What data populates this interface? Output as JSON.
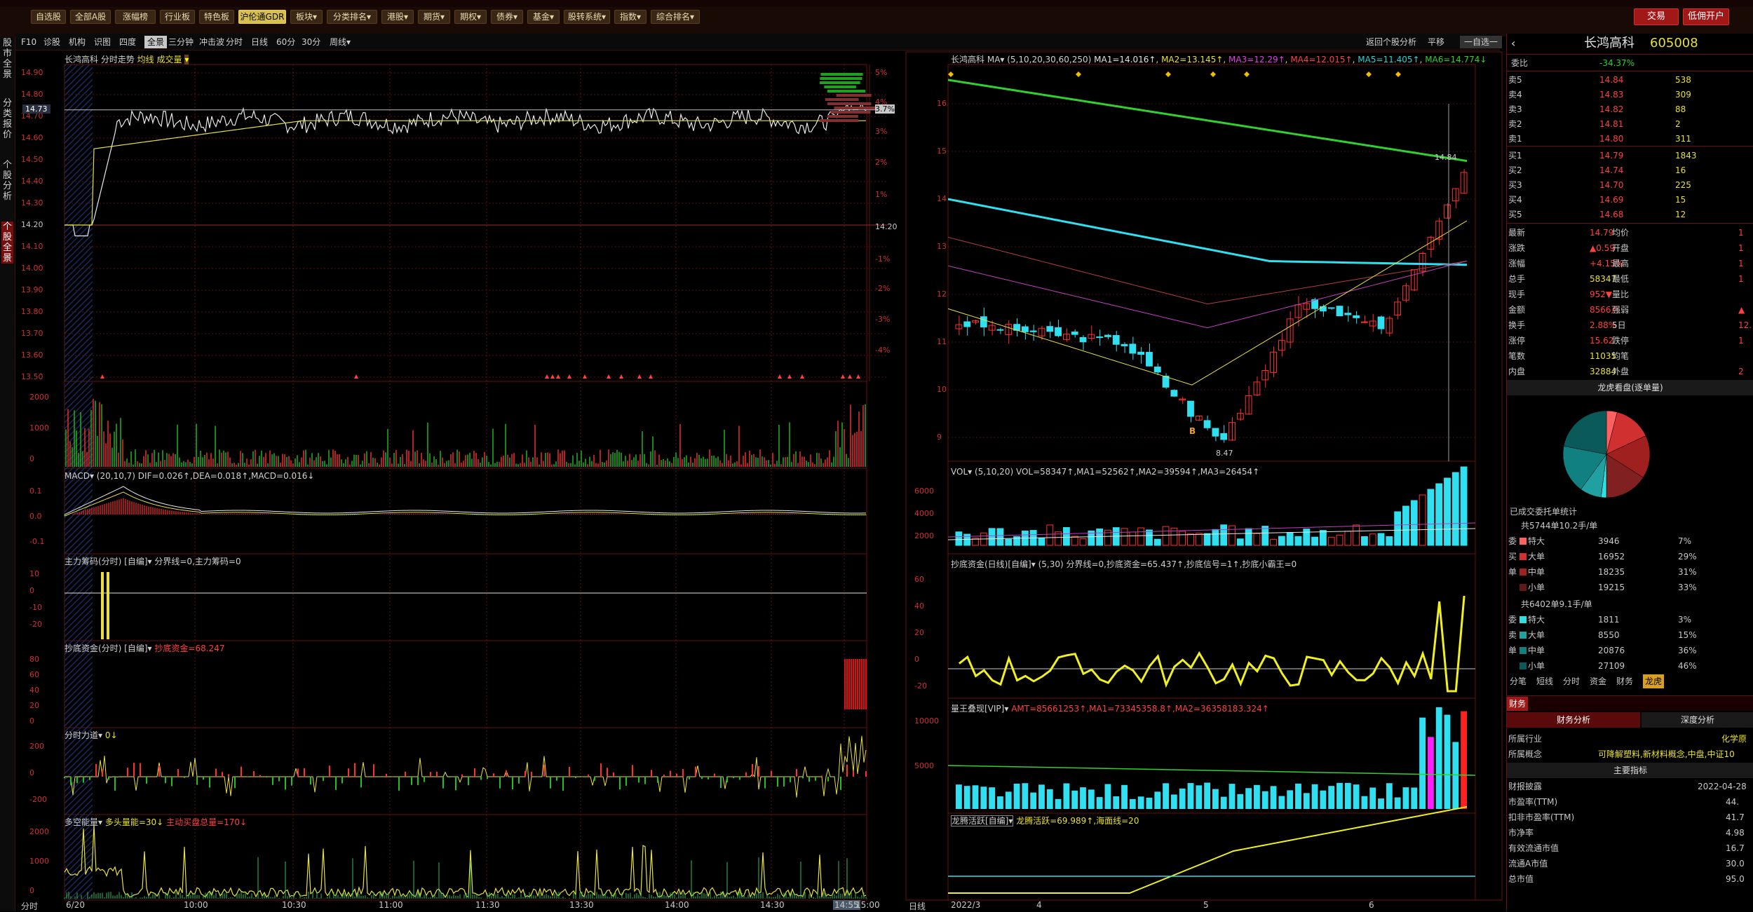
{
  "top": {
    "menu": [
      "自选股",
      "全部A股",
      "涨幅榜",
      "行业板",
      "特色板",
      "沪伦通GDR",
      "板块▾",
      "分类排名▾",
      "港股▾",
      "期货▾",
      "期权▾",
      "债券▾",
      "基金▾",
      "股转系统▾",
      "指数▾",
      "综合排名▾"
    ],
    "trade_btn": "交易",
    "account_btn": "低佣开户"
  },
  "left_tabs": [
    "股市全景",
    "分类报价",
    "个股分析",
    "个股全景"
  ],
  "toolbar": {
    "items": [
      "F10",
      "诊股",
      "机构",
      "识图",
      "四度",
      "全景",
      "三分钟",
      "冲击波",
      "分时",
      "日线",
      "60分",
      "30分",
      "周线▾"
    ],
    "right": [
      "返回个股分析",
      "平移",
      "一自选一"
    ]
  },
  "intraday": {
    "title": "长鸿高科 分时走势",
    "subtitle": "均线 成交量",
    "price_ticks": [
      "14.90",
      "14.80",
      "14.70",
      "14.60",
      "14.50",
      "14.40",
      "14.30",
      "14.20",
      "14.10",
      "14.00",
      "13.90",
      "13.80",
      "13.70",
      "13.60",
      "13.50"
    ],
    "pct_ticks": [
      "5%",
      "4%",
      "3.7%",
      "3%",
      "2%",
      "1%",
      "14.20",
      "-1%",
      "-2%",
      "-3%",
      "-4%"
    ],
    "current_price": "14.73",
    "vol_ticks": [
      "2000",
      "1000",
      "0"
    ],
    "time_ticks": [
      "6/20",
      "10:00",
      "10:30",
      "11:00",
      "11:30",
      "13:30",
      "14:00",
      "14:30",
      "14:55",
      "15:00"
    ],
    "time_label": "分时",
    "macd_title": "MACD▾ (20,10,7) DIF=0.026↑,DEA=0.018↑,MACD=0.016↓",
    "macd_ticks": [
      "0.1",
      "0.0",
      "-0.1"
    ],
    "zl_title": "主力筹码(分时) [自编]▾ 分界线=0,主力筹码=0",
    "zl_ticks": [
      "10",
      "0",
      "-10",
      "-20"
    ],
    "cd_title": "抄底资金(分时) [自编]▾",
    "cd_value": "抄底资金=68.247",
    "cd_ticks": [
      "80",
      "60",
      "40",
      "20",
      "0"
    ],
    "fl_title": "分时力道▾",
    "fl_value": "0↓",
    "fl_ticks": [
      "200",
      "0",
      "-200"
    ],
    "dk_title": "多空能量▾",
    "dk_a": "多头量能=30↓",
    "dk_b": "主动买盘总量=170↓",
    "dk_ticks": [
      "2000",
      "1000",
      "0"
    ]
  },
  "kline": {
    "title": "长鸿高科",
    "ma_label": "MA▾ (5,10,20,30,60,250)",
    "ma_values": [
      "MA1=14.016↑",
      "MA2=13.145↑",
      "MA3=12.29↑",
      "MA4=12.015↑",
      "MA5=11.405↑",
      "MA6=14.774↓"
    ],
    "y_ticks": [
      "16",
      "15",
      "14",
      "13",
      "12",
      "11",
      "10",
      "9"
    ],
    "low_label": "8.47",
    "high_label": "14.84",
    "b_label": "B",
    "vol_title": "VOL▾ (5,10,20) VOL=58347↑,MA1=52562↑,MA2=39594↑,MA3=26454↑",
    "vol_ticks": [
      "6000",
      "4000",
      "2000"
    ],
    "cdzj_title": "抄底资金(日线)[自编]▾ (5,30) 分界线=0,抄底资金=65.437↑,抄底信号=1↑,抄底小霸王=0",
    "cdzj_ticks": [
      "60",
      "40",
      "20",
      "0",
      "-20"
    ],
    "lw_title": "量王叠现[VIP]▾",
    "lw_values": "AMT=85661253↑,MA1=73345358.8↑,MA2=36358183.324↑",
    "lw_ticks": [
      "10000",
      "5000"
    ],
    "lt_title": "龙腾活跃[自编]▾",
    "lt_values": "龙腾活跃=69.989↑,海面线=20",
    "x_ticks": [
      "2022/3",
      "4",
      "5",
      "6"
    ],
    "x_label": "日线"
  },
  "quote": {
    "name": "长鸿高科",
    "code": "605008",
    "weibi": "委比",
    "weibi_val": "-34.37%",
    "asks": [
      [
        "卖5",
        "14.84",
        "538"
      ],
      [
        "卖4",
        "14.83",
        "309"
      ],
      [
        "卖3",
        "14.82",
        "88"
      ],
      [
        "卖2",
        "14.81",
        "2"
      ],
      [
        "卖1",
        "14.80",
        "311"
      ]
    ],
    "bids": [
      [
        "买1",
        "14.79",
        "1843"
      ],
      [
        "买2",
        "14.74",
        "16"
      ],
      [
        "买3",
        "14.70",
        "225"
      ],
      [
        "买4",
        "14.69",
        "15"
      ],
      [
        "买5",
        "14.68",
        "12"
      ]
    ],
    "stats": [
      [
        "最新",
        "14.79",
        "均价",
        "1"
      ],
      [
        "涨跌",
        "▲0.59",
        "开盘",
        "1"
      ],
      [
        "涨幅",
        "+4.15%",
        "最高",
        "1"
      ],
      [
        "总手",
        "58347",
        "最低",
        "1"
      ],
      [
        "现手",
        "952▼",
        "量比",
        ""
      ],
      [
        "金额",
        "8566万",
        "强弱",
        "▲"
      ],
      [
        "换手",
        "2.88%",
        "5日",
        "12."
      ],
      [
        "涨停",
        "15.62",
        "跌停",
        "1"
      ],
      [
        "笔数",
        "11035",
        "均笔",
        ""
      ],
      [
        "内盘",
        "32884",
        "外盘",
        "2"
      ]
    ],
    "dragon_title": "龙虎看盘(逐单量)",
    "orders_title": "已成交委托单统计",
    "buy_total": "共5744单10.2手/单",
    "buy_rows": [
      [
        "特大",
        "3946",
        "7%"
      ],
      [
        "大单",
        "16952",
        "29%"
      ],
      [
        "中单",
        "18235",
        "31%"
      ],
      [
        "小单",
        "19215",
        "33%"
      ]
    ],
    "sell_total": "共6402单9.1手/单",
    "sell_rows": [
      [
        "特大",
        "1811",
        "3%"
      ],
      [
        "大单",
        "8550",
        "15%"
      ],
      [
        "中单",
        "20876",
        "36%"
      ],
      [
        "小单",
        "27109",
        "46%"
      ]
    ],
    "side_labels": [
      "委",
      "买",
      "单",
      "委",
      "卖",
      "单"
    ],
    "tabs": [
      "分笔",
      "短线",
      "分时",
      "资金",
      "财务",
      "龙虎"
    ],
    "fin_tab": "财务",
    "fin_sub": [
      "财务分析",
      "深度分析"
    ],
    "industry_k": "所属行业",
    "industry_v": "化学原",
    "concept_k": "所属概念",
    "concept_v": "可降解塑料,新材料概念,中盘,中证10",
    "main_idx": "主要指标",
    "fin_rows": [
      [
        "财报披露",
        "2022-04-28"
      ],
      [
        "市盈率(TTM)",
        "44."
      ],
      [
        "扣非市盈率(TTM)",
        "41.7"
      ],
      [
        "市净率",
        "4.98"
      ],
      [
        "有效流通市值",
        "16.7"
      ],
      [
        "流通A市值",
        "30.0"
      ],
      [
        "总市值",
        "95.0"
      ]
    ]
  },
  "colors": {
    "up": "#ff3030",
    "down": "#30e0f0",
    "grid": "#6a1010",
    "ma250": "#30d030",
    "ma60": "#30e0f0",
    "ma5": "#ffffff",
    "ma10": "#e8e040",
    "ma20": "#e040e0",
    "ma30": "#d05050"
  }
}
